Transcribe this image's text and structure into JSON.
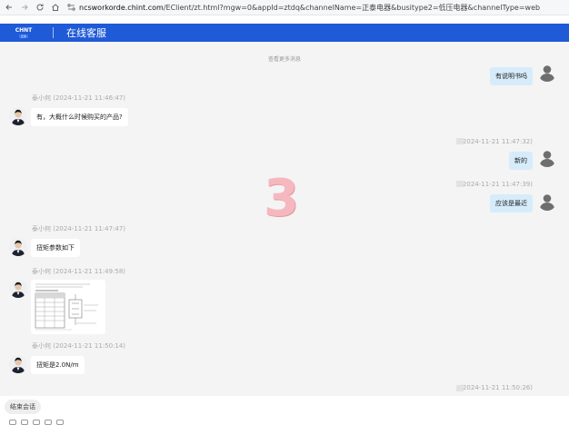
{
  "browser": {
    "url_domain": "ncsworkorde.chint.com",
    "url_rest": "/EClient/zt.html?mgw=0&appId=ztdq&channelName=正泰电器&busitype2=低压电器&channelType=webchat"
  },
  "header": {
    "logo": "CHNT",
    "logo_sub": "正泰",
    "title": "在线客服"
  },
  "chat": {
    "load_more": "查看更多消息",
    "messages": [
      {
        "side": "right",
        "text": "有说明书吗",
        "meta": ""
      },
      {
        "side": "left",
        "meta": "泰小何 (2024-11-21 11:46:47)",
        "text": "有，大概什么时候购买的产品?"
      },
      {
        "side": "right",
        "meta": "(2024-11-21 11:47:32)",
        "text": "新的"
      },
      {
        "side": "right",
        "meta": "(2024-11-21 11:47:39)",
        "text": "应该是最近"
      },
      {
        "side": "left",
        "meta": "泰小何 (2024-11-21 11:47:47)",
        "text": "扭矩参数如下"
      },
      {
        "side": "left",
        "meta": "泰小何 (2024-11-21 11:49:58)",
        "text": ""
      },
      {
        "side": "left",
        "meta": "泰小何 (2024-11-21 11:50:14)",
        "text": "扭矩是2.0N/m"
      },
      {
        "side": "right",
        "meta": "(2024-11-21 11:50:26)",
        "text": ""
      }
    ]
  },
  "watermark": "3",
  "footer": {
    "end_session": "结束会话"
  },
  "colors": {
    "header_blue": "#1f5ad7",
    "user_bubble": "#d6ecfb",
    "chat_bg": "#f4f4f4"
  }
}
